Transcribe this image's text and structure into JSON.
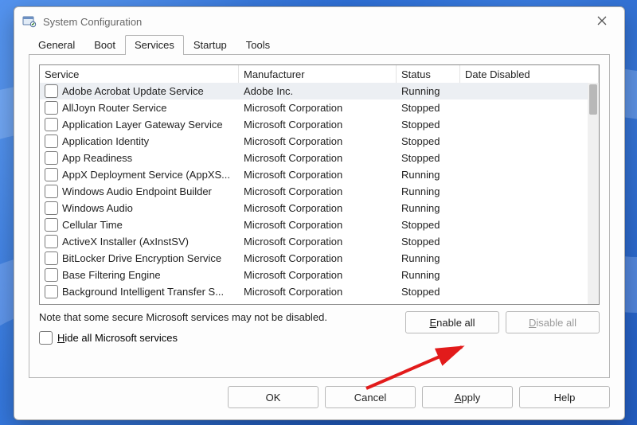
{
  "window": {
    "title": "System Configuration"
  },
  "tabs": [
    "General",
    "Boot",
    "Services",
    "Startup",
    "Tools"
  ],
  "active_tab_index": 2,
  "columns": {
    "service": "Service",
    "manufacturer": "Manufacturer",
    "status": "Status",
    "date_disabled": "Date Disabled"
  },
  "rows": [
    {
      "service": "Adobe Acrobat Update Service",
      "manufacturer": "Adobe Inc.",
      "status": "Running",
      "date": "",
      "selected": true
    },
    {
      "service": "AllJoyn Router Service",
      "manufacturer": "Microsoft Corporation",
      "status": "Stopped",
      "date": "",
      "selected": false
    },
    {
      "service": "Application Layer Gateway Service",
      "manufacturer": "Microsoft Corporation",
      "status": "Stopped",
      "date": "",
      "selected": false
    },
    {
      "service": "Application Identity",
      "manufacturer": "Microsoft Corporation",
      "status": "Stopped",
      "date": "",
      "selected": false
    },
    {
      "service": "App Readiness",
      "manufacturer": "Microsoft Corporation",
      "status": "Stopped",
      "date": "",
      "selected": false
    },
    {
      "service": "AppX Deployment Service (AppXS...",
      "manufacturer": "Microsoft Corporation",
      "status": "Running",
      "date": "",
      "selected": false
    },
    {
      "service": "Windows Audio Endpoint Builder",
      "manufacturer": "Microsoft Corporation",
      "status": "Running",
      "date": "",
      "selected": false
    },
    {
      "service": "Windows Audio",
      "manufacturer": "Microsoft Corporation",
      "status": "Running",
      "date": "",
      "selected": false
    },
    {
      "service": "Cellular Time",
      "manufacturer": "Microsoft Corporation",
      "status": "Stopped",
      "date": "",
      "selected": false
    },
    {
      "service": "ActiveX Installer (AxInstSV)",
      "manufacturer": "Microsoft Corporation",
      "status": "Stopped",
      "date": "",
      "selected": false
    },
    {
      "service": "BitLocker Drive Encryption Service",
      "manufacturer": "Microsoft Corporation",
      "status": "Running",
      "date": "",
      "selected": false
    },
    {
      "service": "Base Filtering Engine",
      "manufacturer": "Microsoft Corporation",
      "status": "Running",
      "date": "",
      "selected": false
    },
    {
      "service": "Background Intelligent Transfer S...",
      "manufacturer": "Microsoft Corporation",
      "status": "Stopped",
      "date": "",
      "selected": false
    }
  ],
  "note": "Note that some secure Microsoft services may not be disabled.",
  "hide_checkbox": {
    "prefix": "H",
    "rest": "ide all Microsoft services"
  },
  "buttons": {
    "enable_all": {
      "prefix": "E",
      "rest": "nable all"
    },
    "disable_all": {
      "prefix": "D",
      "rest": "isable all"
    },
    "ok": "OK",
    "cancel": "Cancel",
    "apply": {
      "prefix": "A",
      "rest": "pply"
    },
    "help": "Help"
  }
}
